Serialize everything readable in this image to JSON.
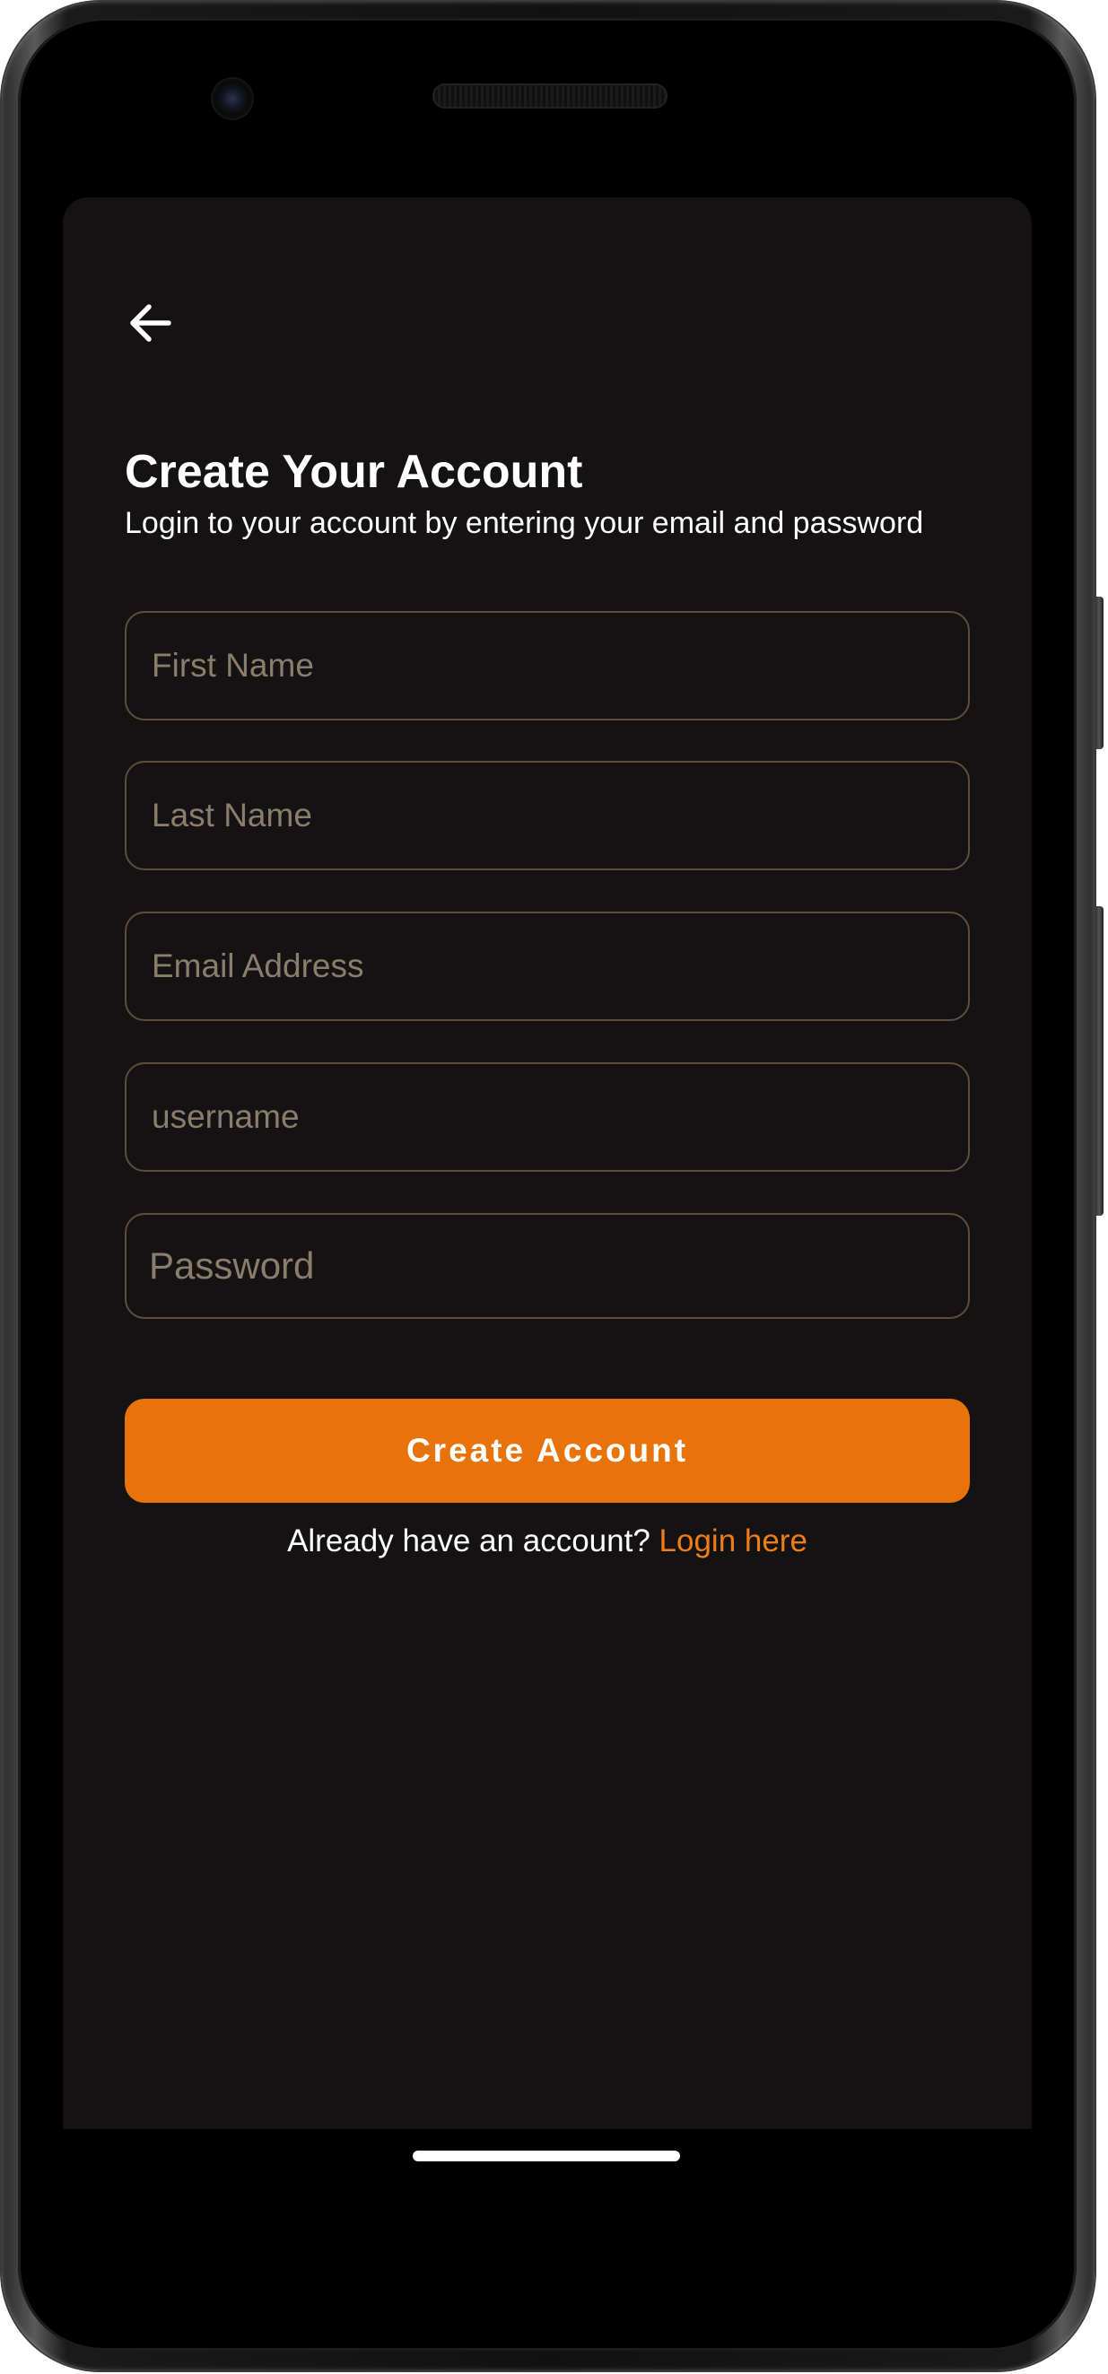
{
  "header": {
    "back_icon": "arrow-left-icon"
  },
  "title": "Create Your Account",
  "subtitle": "Login to your account by entering your email and password",
  "form": {
    "first_name": {
      "placeholder": "First Name",
      "value": ""
    },
    "last_name": {
      "placeholder": "Last Name",
      "value": ""
    },
    "email": {
      "placeholder": "Email Address",
      "value": ""
    },
    "username": {
      "placeholder": "username",
      "value": ""
    },
    "password": {
      "placeholder": "Password",
      "value": ""
    }
  },
  "actions": {
    "create_label": "Create Account",
    "login_prompt": "Already have an account?",
    "login_link": "Login here"
  },
  "colors": {
    "accent": "#e8730b",
    "background": "#141213",
    "field_border": "#5e4d3b",
    "placeholder": "#8b7d6c"
  }
}
